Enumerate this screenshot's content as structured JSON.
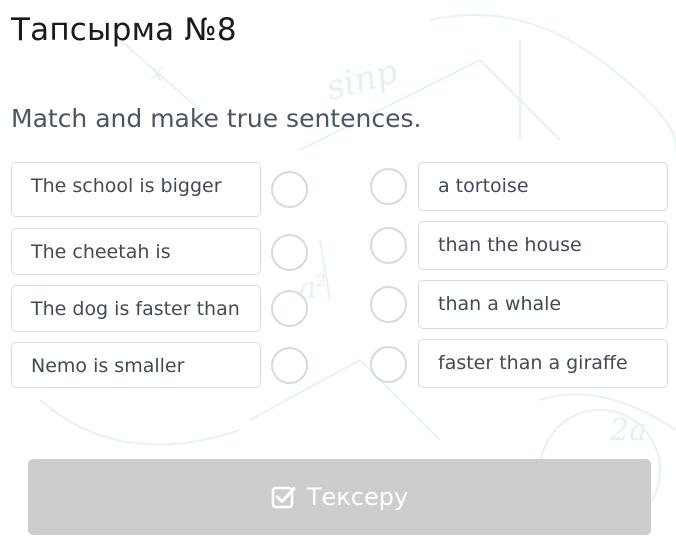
{
  "task": {
    "title": "Тапсырма №8",
    "instruction": "Match and make true sentences."
  },
  "left_items": [
    {
      "label": "The school is bigger"
    },
    {
      "label": "The cheetah is"
    },
    {
      "label": "The dog is faster than"
    },
    {
      "label": "Nemo is smaller"
    }
  ],
  "right_items": [
    {
      "label": "a tortoise"
    },
    {
      "label": "than the house"
    },
    {
      "label": "than a whale"
    },
    {
      "label": "faster than a giraffe"
    }
  ],
  "check_button": {
    "label": "Тексеру",
    "icon": "check-square-icon",
    "state": "disabled"
  },
  "colors": {
    "title_text": "#1b1b1b",
    "body_text": "#414b55",
    "border": "#d7dee4",
    "button_disabled": "#cdcdcd",
    "background_pattern": "#e6f4ee"
  }
}
